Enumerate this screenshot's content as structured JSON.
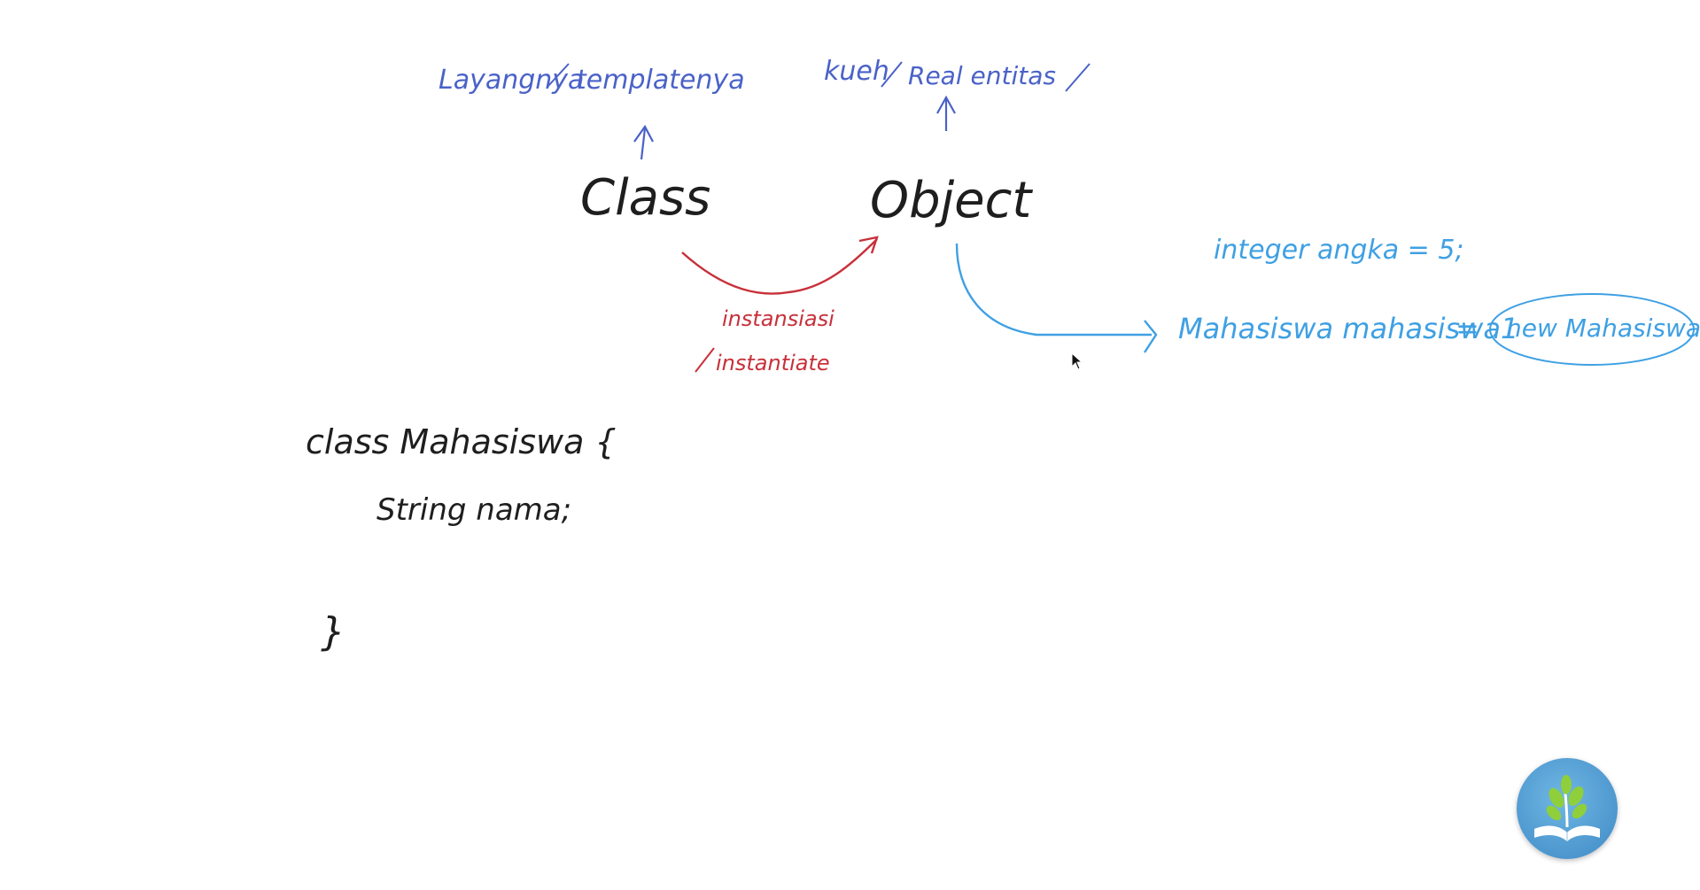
{
  "whiteboard": {
    "top_left_note": {
      "part1": "Layangnya",
      "part2": "templatenya"
    },
    "top_right_note": {
      "part1": "kueh",
      "part2": "Real entitas"
    },
    "class_word": "Class",
    "object_word": "Object",
    "instantiation_label": "instansiasi",
    "instantiate_label": "instantiate",
    "primitive_example": "integer angka = 5;",
    "object_example": {
      "declaration": "Mahasiswa mahasiswa1",
      "equals": "=",
      "constructor_call": "new Mahasiswa();"
    },
    "code": {
      "line1": "class Mahasiswa {",
      "line2": "String nama;",
      "line3": "}"
    }
  },
  "colors": {
    "background": "#ffffff",
    "blue_ink": "#4a62c8",
    "sky_ink": "#3fa0e3",
    "red_ink": "#c8303a",
    "black_ink": "#1e1e1e",
    "logo_circle": "#5aa6da",
    "logo_leaves": "#8fcf3c"
  },
  "icons": {
    "logo": "book-plant-logo",
    "cursor": "mouse-pointer-icon"
  }
}
